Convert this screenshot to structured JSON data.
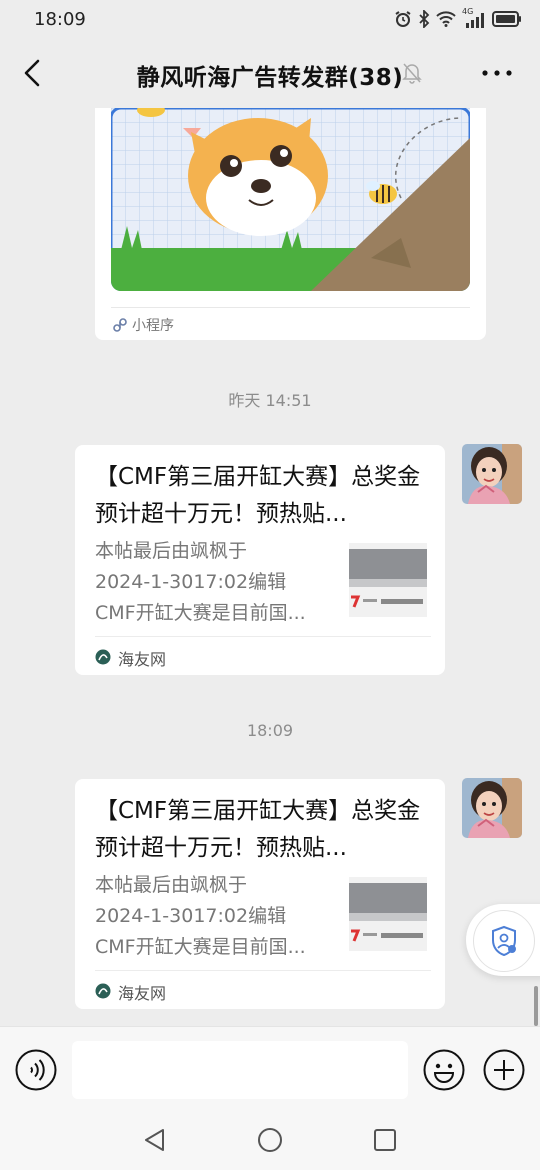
{
  "status_bar": {
    "time": "18:09",
    "network": "4G"
  },
  "header": {
    "title": "静风听海广告转发群(38)"
  },
  "mini_program": {
    "label": "小程序"
  },
  "timestamps": [
    "昨天 14:51",
    "18:09"
  ],
  "messages": [
    {
      "title": "【CMF第三届开缸大赛】总奖金预计超十万元！预热贴...",
      "desc_lines": [
        "本帖最后由飒枫于",
        "2024-1-3017:02编辑",
        "CMF开缸大赛是目前国..."
      ],
      "source": "海友网"
    },
    {
      "title": "【CMF第三届开缸大赛】总奖金预计超十万元！预热贴...",
      "desc_lines": [
        "本帖最后由飒枫于",
        "2024-1-3017:02编辑",
        "CMF开缸大赛是目前国..."
      ],
      "source": "海友网"
    }
  ],
  "input": {
    "value": "",
    "placeholder": ""
  },
  "colors": {
    "background": "#ededed",
    "card": "#ffffff",
    "accent_blue": "#3b78d8",
    "grass": "#4caf3f"
  }
}
